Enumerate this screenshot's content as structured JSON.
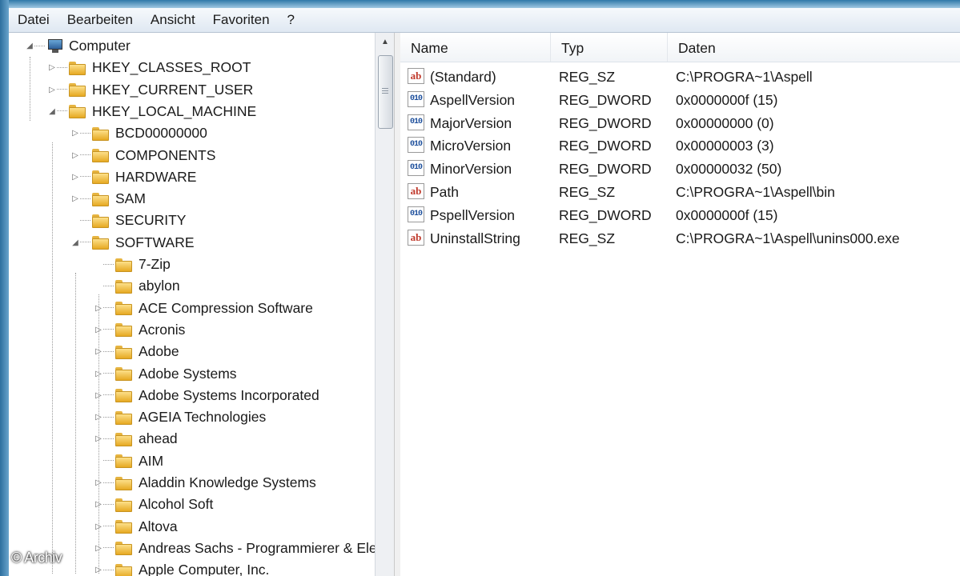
{
  "menu": [
    "Datei",
    "Bearbeiten",
    "Ansicht",
    "Favoriten",
    "?"
  ],
  "tree": {
    "root": "Computer",
    "hives": [
      "HKEY_CLASSES_ROOT",
      "HKEY_CURRENT_USER",
      "HKEY_LOCAL_MACHINE"
    ],
    "hklm_children": [
      "BCD00000000",
      "COMPONENTS",
      "HARDWARE",
      "SAM",
      "SECURITY",
      "SOFTWARE"
    ],
    "software_children": [
      "7-Zip",
      "abylon",
      "ACE Compression Software",
      "Acronis",
      "Adobe",
      "Adobe Systems",
      "Adobe Systems Incorporated",
      "AGEIA Technologies",
      "ahead",
      "AIM",
      "Aladdin Knowledge Systems",
      "Alcohol Soft",
      "Altova",
      "Andreas Sachs - Programmierer & Ele",
      "Apple Computer, Inc."
    ]
  },
  "list": {
    "columns": [
      "Name",
      "Typ",
      "Daten"
    ],
    "rows": [
      {
        "name": "(Standard)",
        "type": "REG_SZ",
        "data": "C:\\PROGRA~1\\Aspell",
        "icon": "string-value-icon"
      },
      {
        "name": "AspellVersion",
        "type": "REG_DWORD",
        "data": "0x0000000f (15)",
        "icon": "dword-value-icon"
      },
      {
        "name": "MajorVersion",
        "type": "REG_DWORD",
        "data": "0x00000000 (0)",
        "icon": "dword-value-icon"
      },
      {
        "name": "MicroVersion",
        "type": "REG_DWORD",
        "data": "0x00000003 (3)",
        "icon": "dword-value-icon"
      },
      {
        "name": "MinorVersion",
        "type": "REG_DWORD",
        "data": "0x00000032 (50)",
        "icon": "dword-value-icon"
      },
      {
        "name": "Path",
        "type": "REG_SZ",
        "data": "C:\\PROGRA~1\\Aspell\\bin",
        "icon": "string-value-icon"
      },
      {
        "name": "PspellVersion",
        "type": "REG_DWORD",
        "data": "0x0000000f (15)",
        "icon": "dword-value-icon"
      },
      {
        "name": "UninstallString",
        "type": "REG_SZ",
        "data": "C:\\PROGRA~1\\Aspell\\unins000.exe",
        "icon": "string-value-icon"
      }
    ]
  },
  "watermark": "© Archiv"
}
